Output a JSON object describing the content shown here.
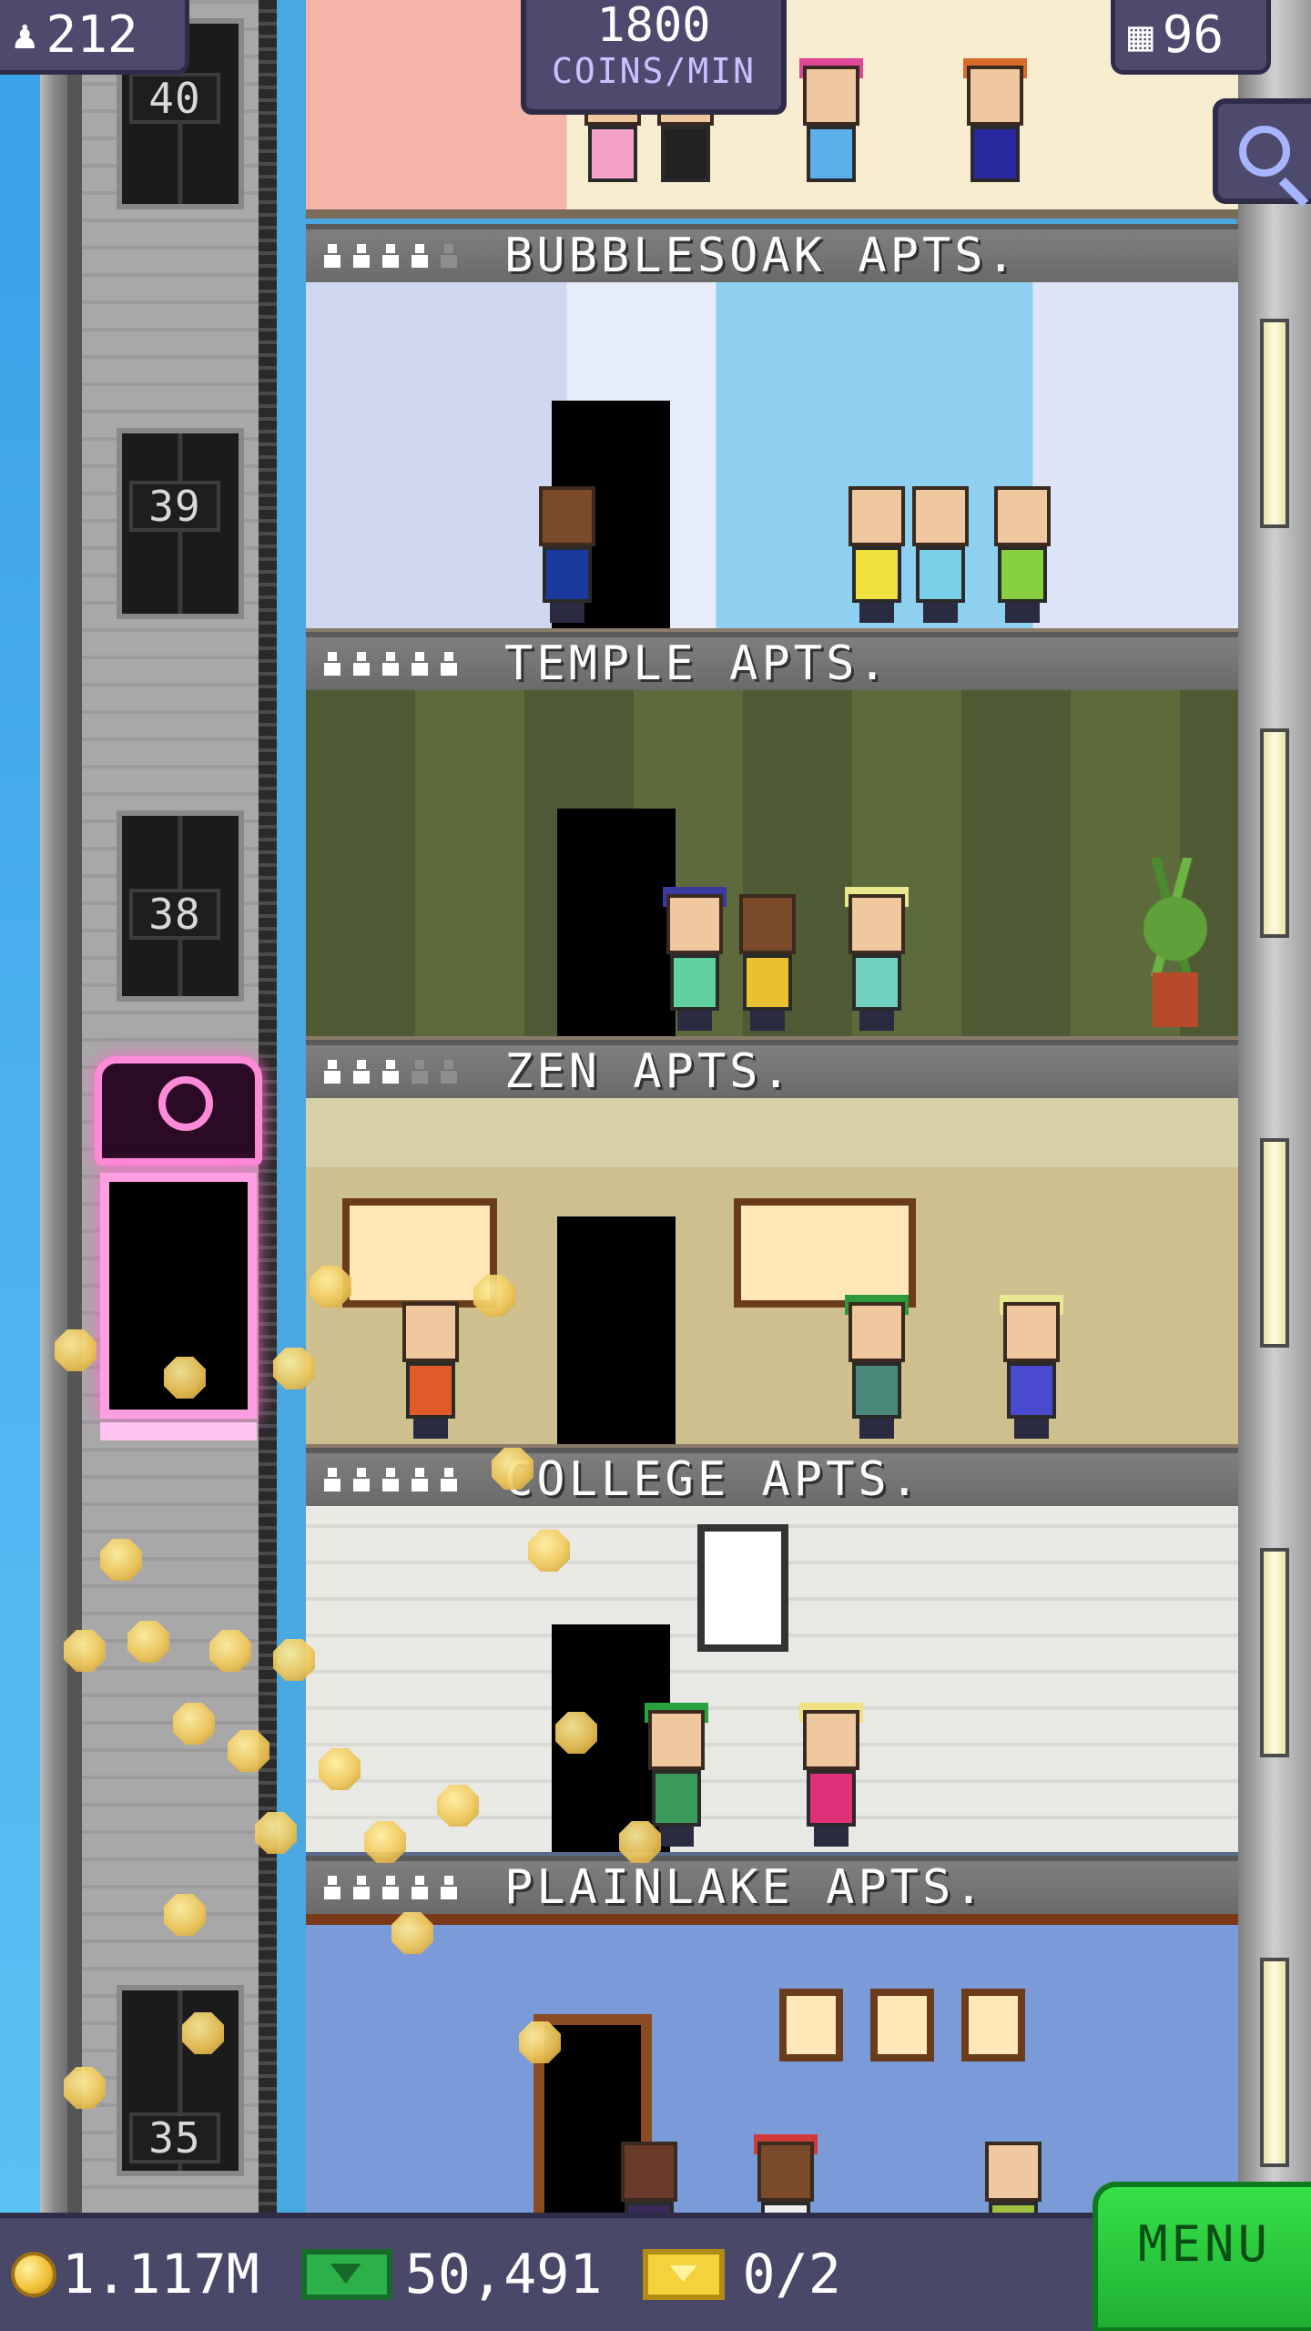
{
  "hud": {
    "population": "212",
    "stories": "96",
    "coins_rate_value": "1800",
    "coins_rate_unit": "COINS/MIN",
    "population_icon": "person-icon",
    "stories_icon": "building-icon",
    "search_icon": "magnifier-icon"
  },
  "shaft": {
    "floor_numbers": [
      "40",
      "39",
      "38",
      "35"
    ]
  },
  "floors": [
    {
      "name": "BUBBLESOAK APTS.",
      "residents": 4,
      "capacity": 5
    },
    {
      "name": "TEMPLE APTS.",
      "residents": 5,
      "capacity": 5
    },
    {
      "name": "ZEN APTS.",
      "residents": 3,
      "capacity": 5
    },
    {
      "name": "COLLEGE APTS.",
      "residents": 5,
      "capacity": 5
    },
    {
      "name": "PLAINLAKE APTS.",
      "residents": 5,
      "capacity": 5
    }
  ],
  "bottom_bar": {
    "coins": "1.117M",
    "bux": "50,491",
    "tickets": "0/2",
    "menu_label": "MENU"
  },
  "colors": {
    "hud_bg": "#4d4a6e",
    "menu_green": "#2cd140",
    "elevator_pink": "#ff8ad8",
    "coin_gold": "#f1c33a"
  }
}
